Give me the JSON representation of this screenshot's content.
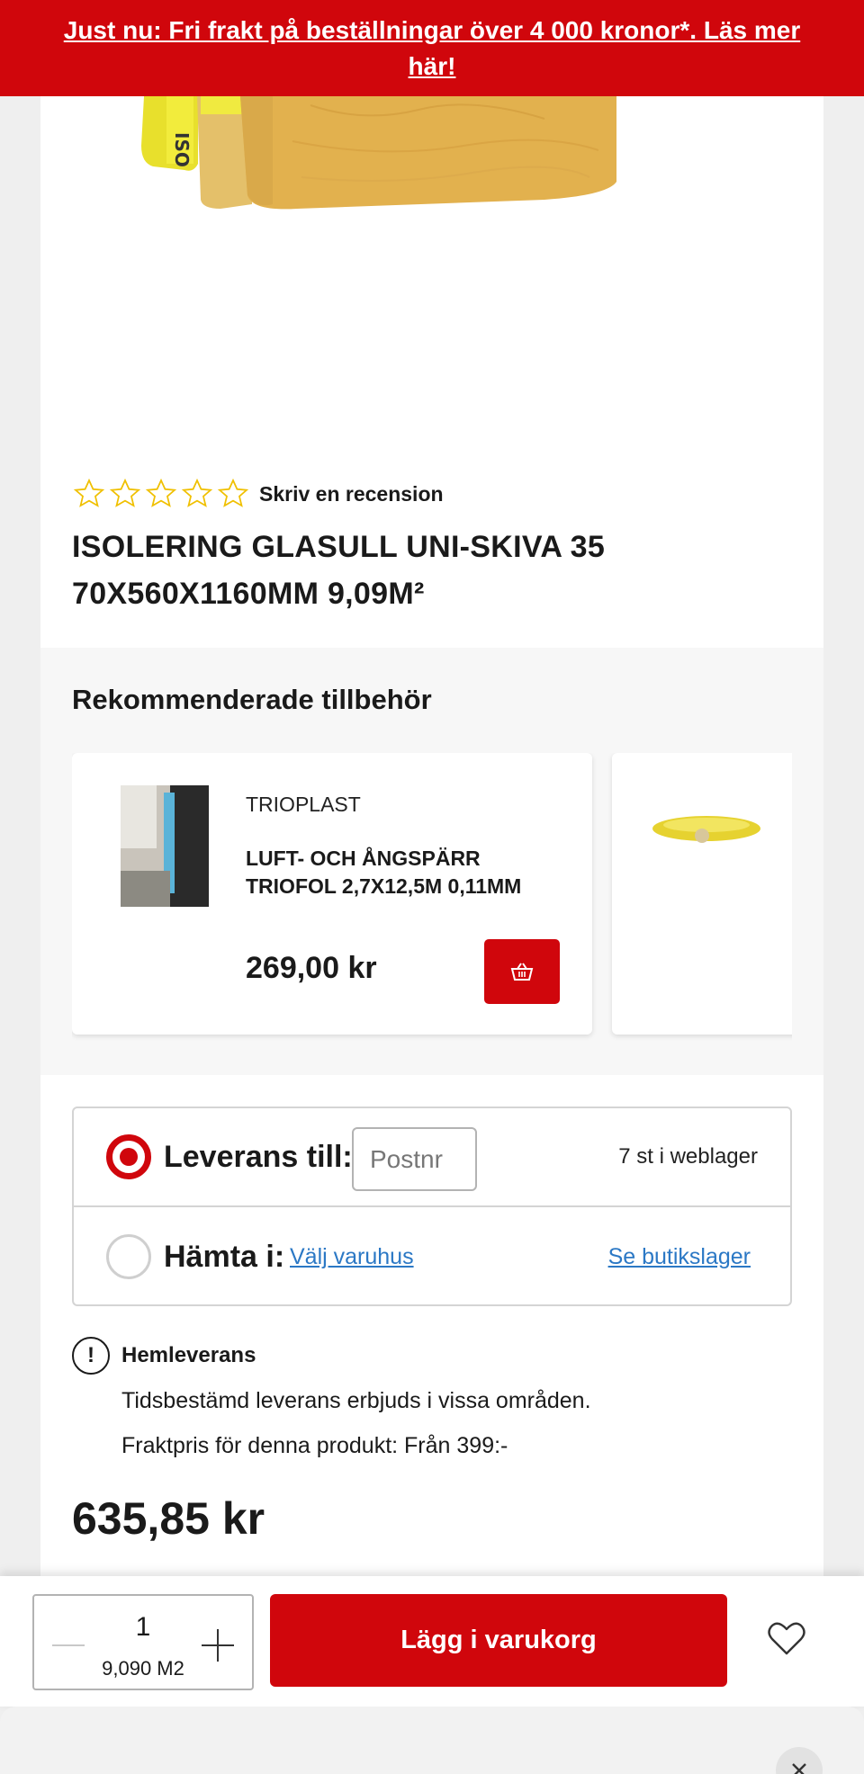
{
  "banner": {
    "text": "Just nu: Fri frakt på beställningar över 4 000 kronor*. Läs mer här!"
  },
  "product": {
    "rating_stars": 0,
    "review_link": "Skriv en recension",
    "title": "ISOLERING GLASULL UNI-SKIVA 35 70X560X1160MM 9,09M²",
    "price": "635,85 kr"
  },
  "recommended": {
    "title": "Rekommenderade tillbehör",
    "items": [
      {
        "brand": "TRIOPLAST",
        "name": "LUFT- OCH ÅNGSPÄRR TRIOFOL 2,7X12,5M 0,11MM",
        "price": "269,00 kr",
        "cart_icon": "basket-icon"
      }
    ]
  },
  "delivery": {
    "option_delivery_label": "Leverans till:",
    "postnr_placeholder": "Postnr",
    "stock": "7 st i weblager",
    "option_pickup_label": "Hämta i:",
    "choose_store": "Välj varuhus",
    "see_store_stock": "Se butikslager"
  },
  "info": {
    "icon": "exclamation-icon",
    "title": "Hemleverans",
    "line1": "Tidsbestämd leverans erbjuds i vissa områden.",
    "line2": "Fraktpris för denna produkt: Från 399:-"
  },
  "bottom_bar": {
    "quantity": "1",
    "quantity_unit": "9,090 M2",
    "add_to_cart": "Lägg i varukorg",
    "wishlist_icon": "heart-icon"
  },
  "colors": {
    "brand_red": "#d0060c",
    "link_blue": "#2b78c5",
    "product_yellow": "#e6b74f"
  }
}
